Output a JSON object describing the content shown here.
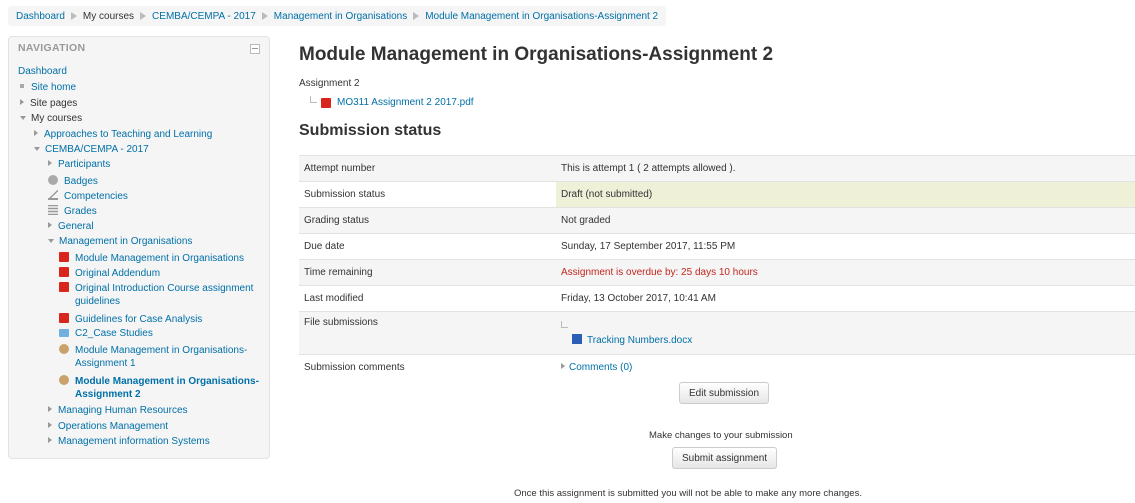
{
  "breadcrumb": [
    "Dashboard",
    "My courses",
    "CEMBA/CEMPA - 2017",
    "Management in Organisations",
    "Module Management in Organisations-Assignment 2"
  ],
  "nav": {
    "heading": "NAVIGATION",
    "dashboard": "Dashboard",
    "site_home": "Site home",
    "site_pages": "Site pages",
    "my_courses": "My courses",
    "approaches": "Approaches to Teaching and Learning",
    "cemba": "CEMBA/CEMPA - 2017",
    "participants": "Participants",
    "badges": "Badges",
    "competencies": "Competencies",
    "grades": "Grades",
    "general": "General",
    "mgmt_org": "Management in Organisations",
    "items": {
      "mod_mgmt": "Module Management in Organisations",
      "orig_add": "Original Addendum",
      "orig_intro_1": "Original Introduction Course assignment",
      "orig_intro_2": "guidelines",
      "guidelines": "Guidelines for Case Analysis",
      "c2": "C2_Case Studies",
      "assign1_1": "Module Management in Organisations-",
      "assign1_2": "Assignment 1",
      "assign2_1": "Module Management in Organisations-",
      "assign2_2": "Assignment 2"
    },
    "hr": "Managing Human Resources",
    "ops": "Operations Management",
    "mis": "Management information Systems"
  },
  "main": {
    "title": "Module Management in Organisations-Assignment 2",
    "subtitle": "Assignment 2",
    "attachment": "MO311 Assignment 2 2017.pdf",
    "section": "Submission status"
  },
  "status": {
    "attempt_label": "Attempt number",
    "attempt_value": "This is attempt 1 ( 2 attempts allowed ).",
    "submission_label": "Submission status",
    "submission_value": "Draft (not submitted)",
    "grading_label": "Grading status",
    "grading_value": "Not graded",
    "due_label": "Due date",
    "due_value": "Sunday, 17 September 2017, 11:55 PM",
    "remaining_label": "Time remaining",
    "remaining_value": "Assignment is overdue by: 25 days 10 hours",
    "modified_label": "Last modified",
    "modified_value": "Friday, 13 October 2017, 10:41 AM",
    "files_label": "File submissions",
    "file_name": "Tracking Numbers.docx",
    "comments_label": "Submission comments",
    "comments_value": "Comments (0)"
  },
  "actions": {
    "edit_button": "Edit submission",
    "make_changes": "Make changes to your submission",
    "submit_button": "Submit assignment",
    "submit_note": "Once this assignment is submitted you will not be able to make any more changes."
  },
  "colors": {
    "link": "#0070a8",
    "overdue": "#c2271d",
    "draft_bg": "#eef0d8"
  }
}
